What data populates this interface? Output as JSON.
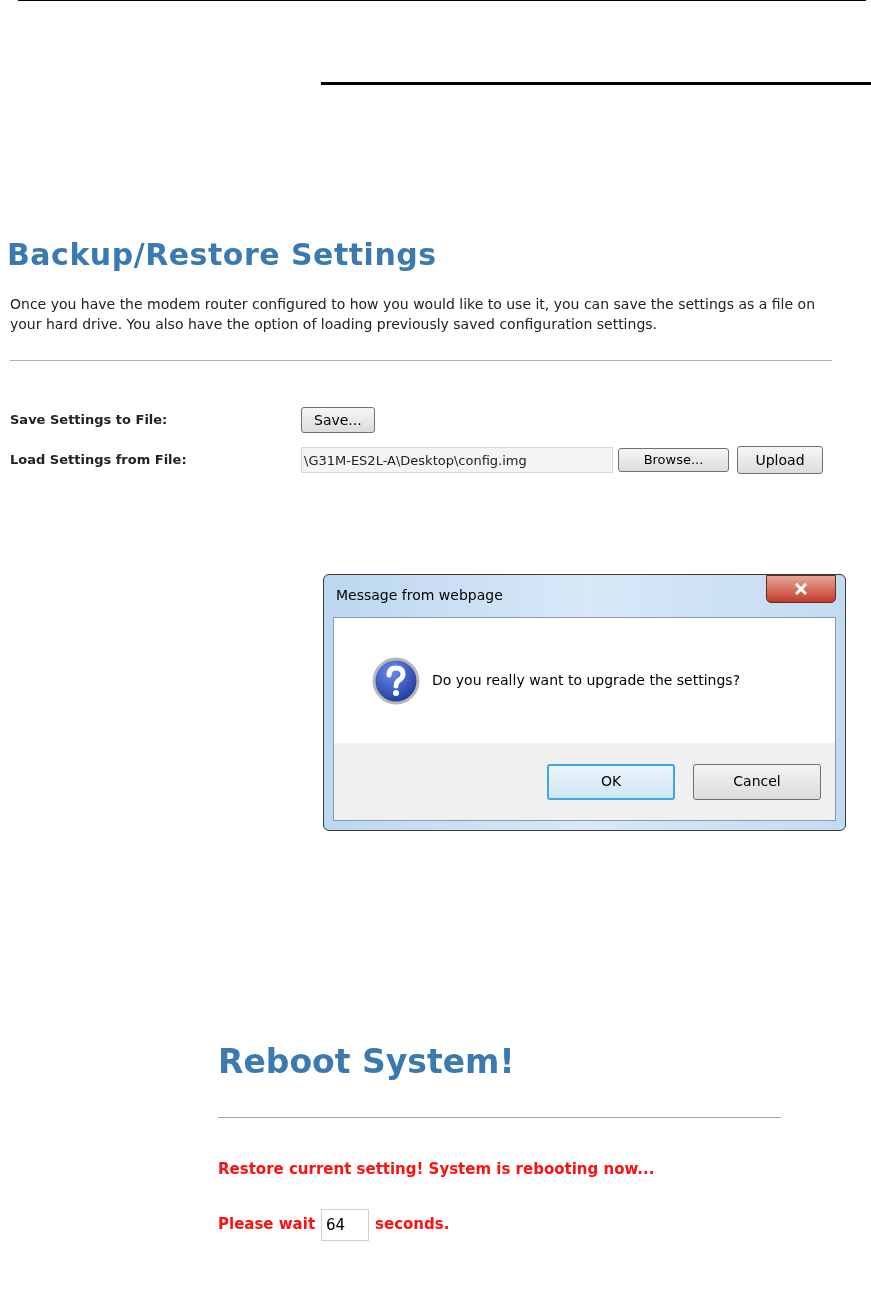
{
  "backup": {
    "title": "Backup/Restore Settings",
    "description": "Once you have the modem router configured to how you would like to use it, you can save the settings as a file on your hard drive. You also have the option of loading previously saved configuration settings.",
    "save_row": {
      "label": "Save Settings to File:",
      "button": "Save..."
    },
    "load_row": {
      "label": "Load Settings from File:",
      "value": "\\G31M-ES2L-A\\Desktop\\config.img",
      "browse_button": "Browse...",
      "upload_button": "Upload"
    }
  },
  "dialog": {
    "title": "Message from webpage",
    "message": "Do you really want to upgrade the settings?",
    "buttons": [
      {
        "label": "OK",
        "selected": true
      },
      {
        "label": "Cancel",
        "selected": false
      }
    ]
  },
  "reboot": {
    "title": "Reboot System!",
    "status": "Restore current setting! System is rebooting now...",
    "wait_prefix": "Please wait",
    "wait_value": "64",
    "wait_suffix": "seconds."
  }
}
